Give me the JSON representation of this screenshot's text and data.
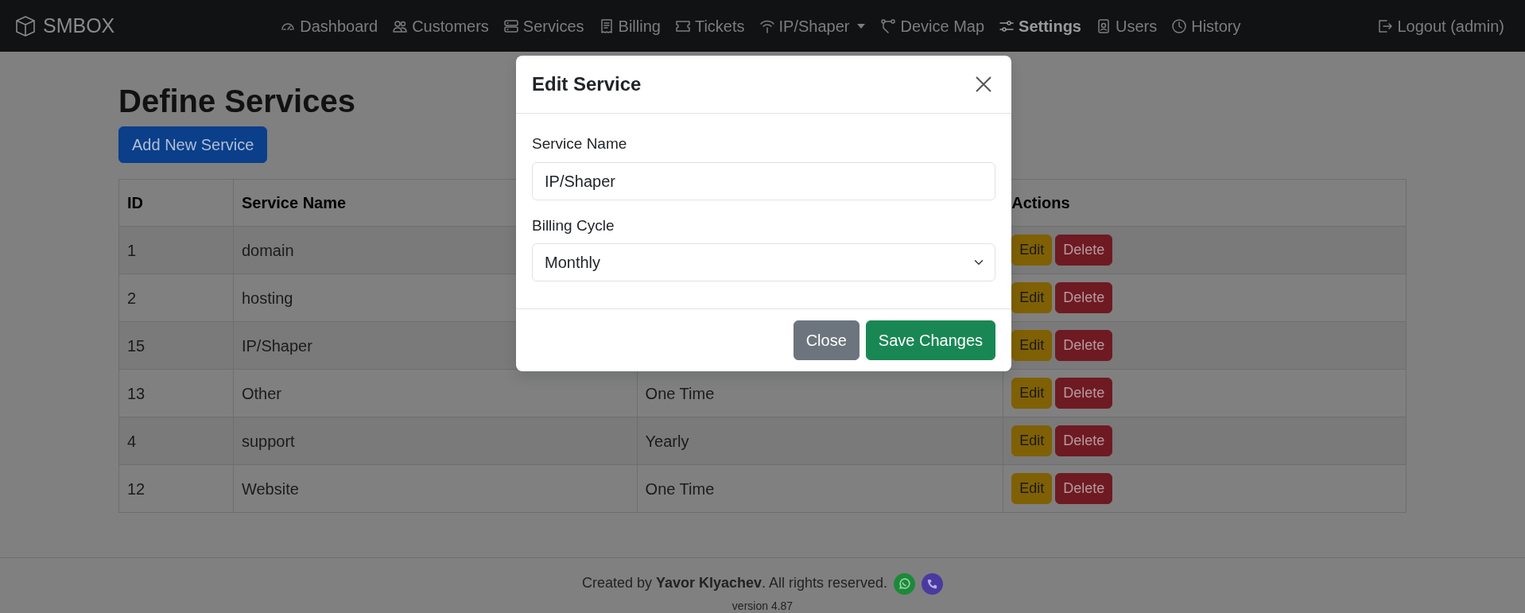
{
  "navbar": {
    "brand": "SMBOX",
    "items": [
      {
        "label": "Dashboard",
        "selected": false,
        "dropdown": false
      },
      {
        "label": "Customers",
        "selected": false,
        "dropdown": false
      },
      {
        "label": "Services",
        "selected": false,
        "dropdown": false
      },
      {
        "label": "Billing",
        "selected": false,
        "dropdown": false
      },
      {
        "label": "Tickets",
        "selected": false,
        "dropdown": false
      },
      {
        "label": "IP/Shaper",
        "selected": false,
        "dropdown": true
      },
      {
        "label": "Device Map",
        "selected": false,
        "dropdown": false
      },
      {
        "label": "Settings",
        "selected": true,
        "dropdown": false
      },
      {
        "label": "Users",
        "selected": false,
        "dropdown": false
      },
      {
        "label": "History",
        "selected": false,
        "dropdown": false
      }
    ],
    "logout": "Logout (admin)"
  },
  "page": {
    "title": "Define Services",
    "add_button": "Add New Service"
  },
  "table": {
    "columns": {
      "id": "ID",
      "service_name": "Service Name",
      "actions": "Actions"
    },
    "rows": [
      {
        "id": "1",
        "service_name": "domain",
        "edit": "Edit",
        "delete": "Delete"
      },
      {
        "id": "2",
        "service_name": "hosting",
        "edit": "Edit",
        "delete": "Delete"
      },
      {
        "id": "15",
        "service_name": "IP/Shaper",
        "edit": "Edit",
        "delete": "Delete"
      },
      {
        "id": "13",
        "service_name": "Other",
        "column_3": "One Time",
        "edit": "Edit",
        "delete": "Delete"
      },
      {
        "id": "4",
        "service_name": "support",
        "column_3": "Yearly",
        "edit": "Edit",
        "delete": "Delete"
      },
      {
        "id": "12",
        "service_name": "Website",
        "column_3": "One Time",
        "edit": "Edit",
        "delete": "Delete"
      }
    ]
  },
  "footer": {
    "credit": "Created by **Yavor Klyachev**. All rights reserved.",
    "version": "version 4.87"
  },
  "modal": {
    "title": "Edit Service",
    "fields": [
      {
        "kind": "text",
        "label": "Service Name",
        "value": "IP/Shaper"
      },
      {
        "kind": "select",
        "label": "Billing Cycle",
        "value": "Monthly"
      }
    ],
    "buttons": [
      {
        "kind": "secondary",
        "label": "Close"
      },
      {
        "kind": "success",
        "label": "Save Changes"
      }
    ]
  }
}
